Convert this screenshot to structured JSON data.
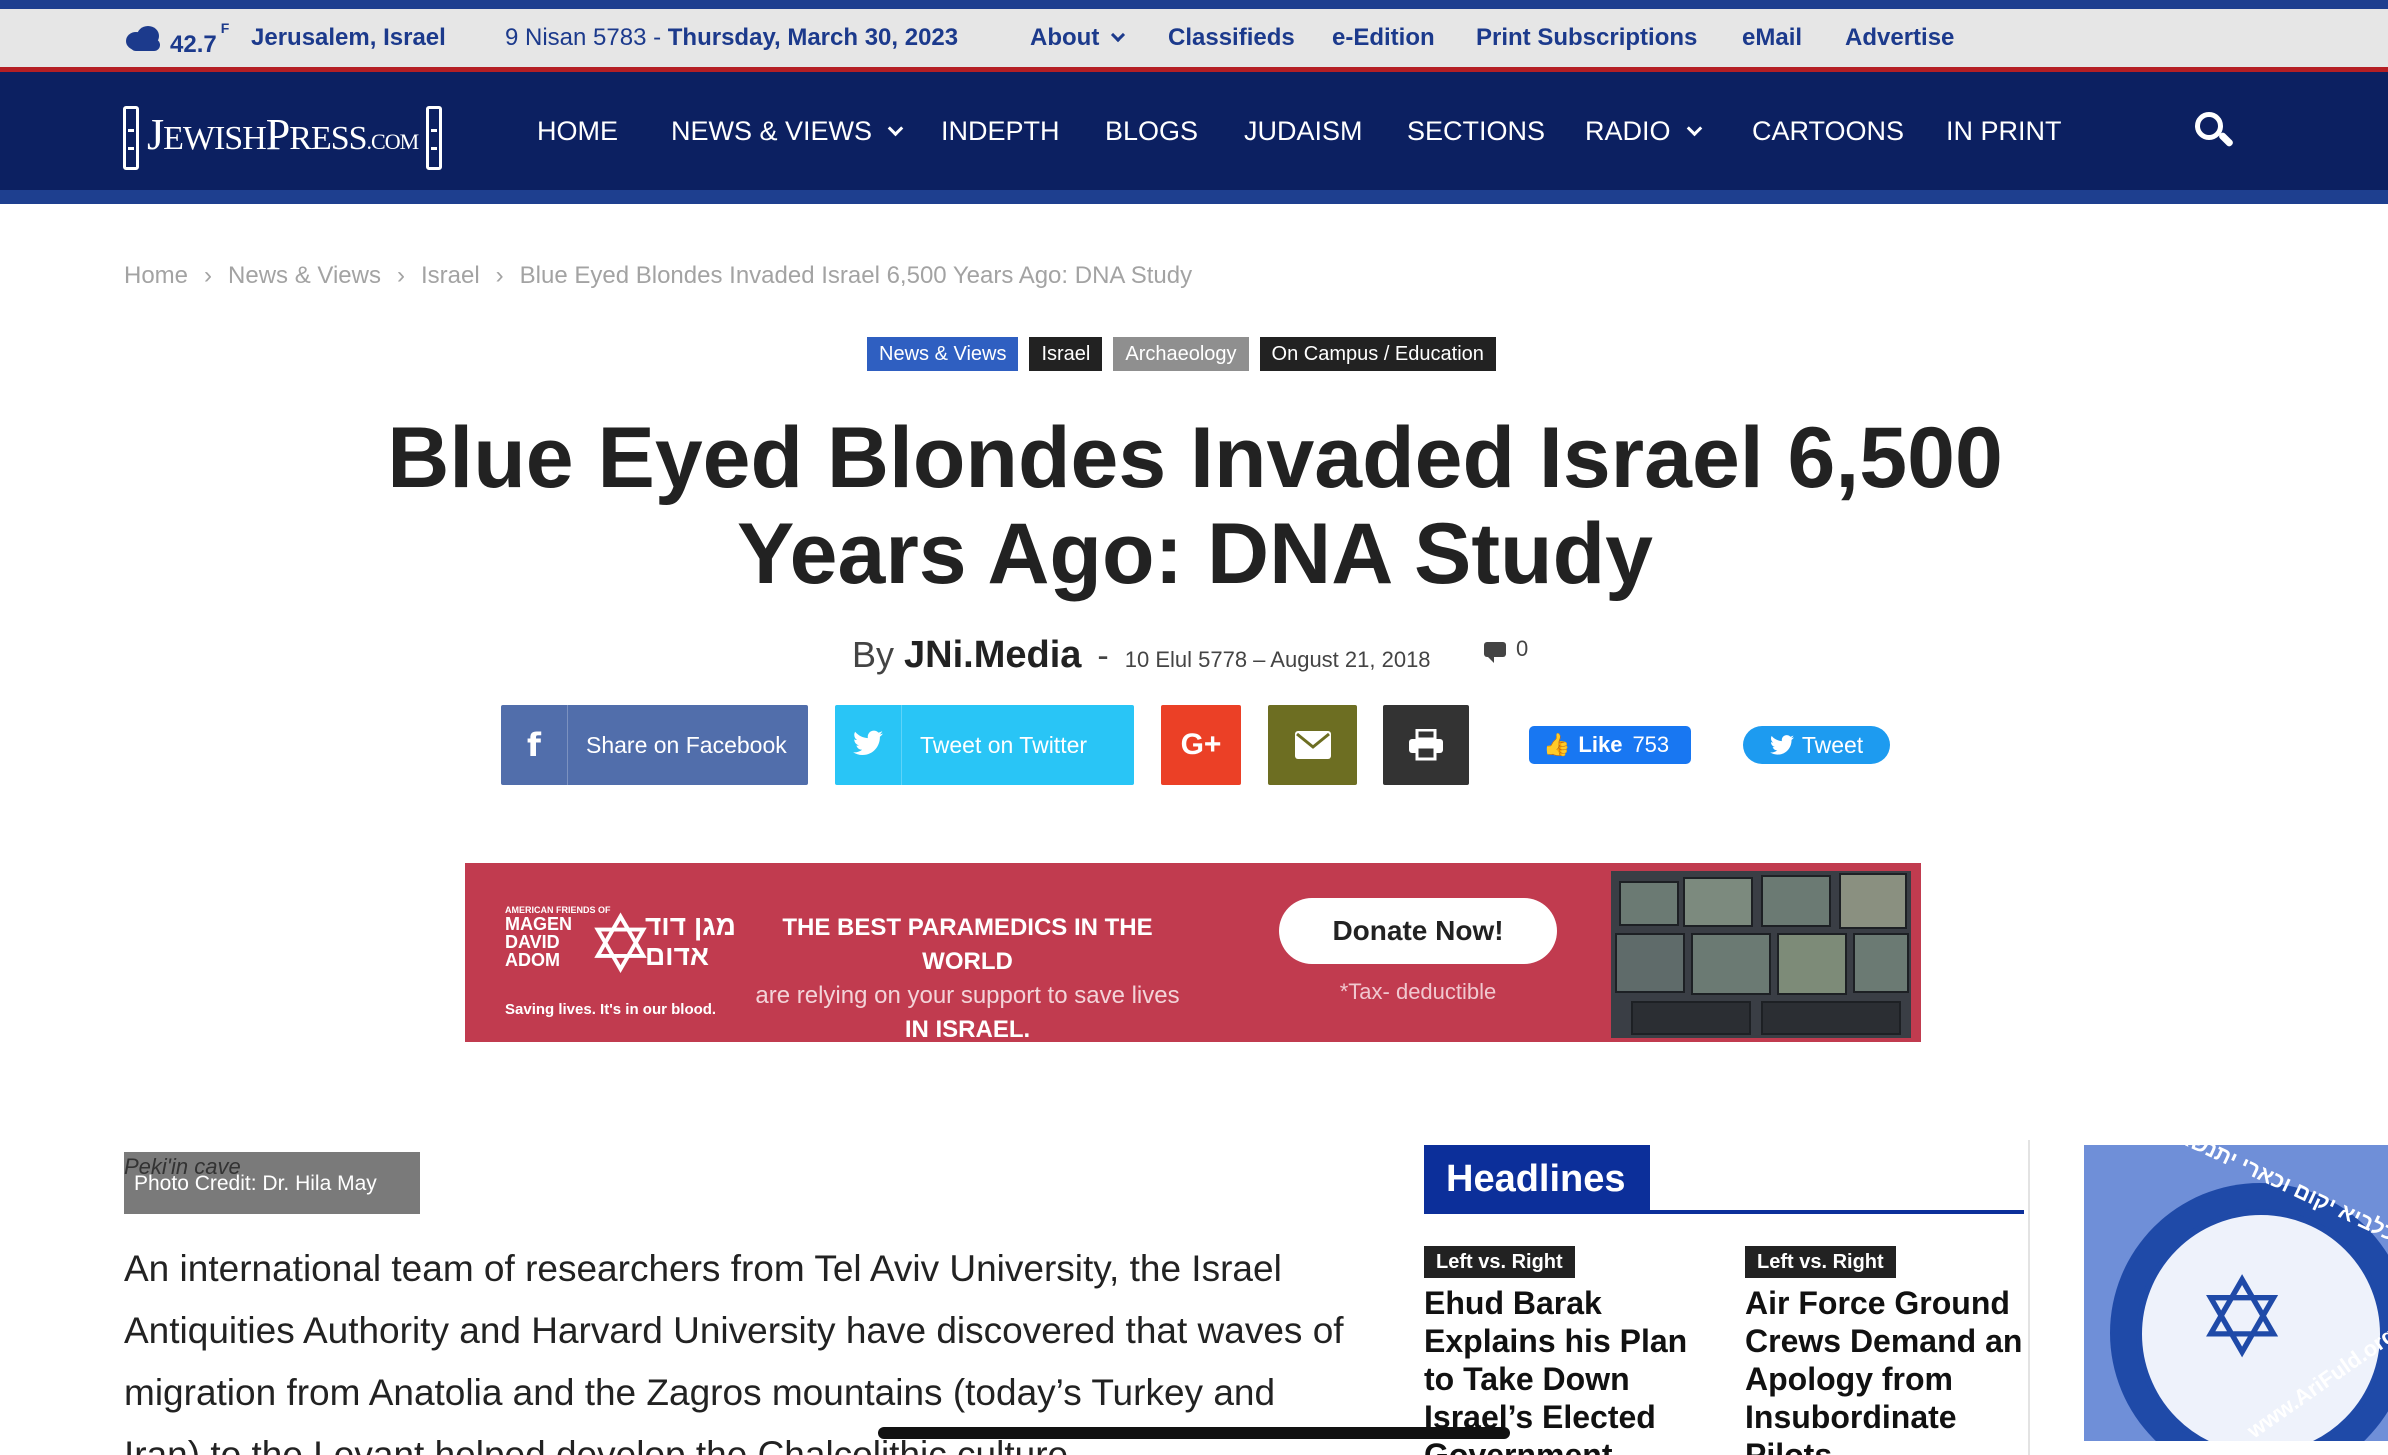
{
  "topbar": {
    "weather_icon": "cloud-icon",
    "temperature": "42.7",
    "temp_unit": "F",
    "location": "Jerusalem, Israel",
    "hebrew_date": "9 Nisan 5783 - ",
    "date": "Thursday, March 30, 2023",
    "links": [
      "About",
      "Classifieds",
      "e-Edition",
      "Print Subscriptions",
      "eMail",
      "Advertise"
    ]
  },
  "mainnav": {
    "logo_text": {
      "j": "J",
      "ewish": "EWISH",
      "p": "P",
      "ress": "RESS",
      "com": ".COM"
    },
    "items": [
      "HOME",
      "NEWS & VIEWS",
      "INDEPTH",
      "BLOGS",
      "JUDAISM",
      "SECTIONS",
      "RADIO",
      "CARTOONS",
      "IN PRINT"
    ],
    "search_icon": "search-icon"
  },
  "breadcrumb": [
    "Home",
    "News & Views",
    "Israel",
    "Blue Eyed Blondes Invaded Israel 6,500 Years Ago: DNA Study"
  ],
  "tags": [
    {
      "label": "News & Views",
      "color": "#2f5fc1"
    },
    {
      "label": "Israel",
      "color": "#222222"
    },
    {
      "label": "Archaeology",
      "color": "#8f8f8f"
    },
    {
      "label": "On Campus / Education",
      "color": "#222222"
    }
  ],
  "article": {
    "title": "Blue Eyed Blondes Invaded Israel 6,500 Years Ago: DNA Study",
    "by": "By",
    "author": "JNi.Media",
    "dash": "-",
    "date": "10 Elul 5778 – August 21, 2018",
    "comment_count": "0",
    "photo_caption": "Peki'in cave",
    "photo_credit": "Photo Credit: Dr. Hila May",
    "body": "An international team of researchers from Tel Aviv University, the Israel Antiquities Authority and Harvard University have discovered that waves of migration from Anatolia and the Zagros mountains (today’s Turkey and Iran) to the Levant helped develop the Chalcolithic culture"
  },
  "share": {
    "facebook": "Share on Facebook",
    "twitter": "Tweet on Twitter",
    "googleplus": "G+",
    "like_label": "Like",
    "like_count": "753",
    "tweet_label": "Tweet"
  },
  "ad": {
    "org_small": "AMERICAN FRIENDS OF",
    "org_name_1": "MAGEN",
    "org_name_2": "DAVID",
    "org_name_3": "ADOM",
    "org_hebrew_1": "מגן דוד",
    "org_hebrew_2": "אדום",
    "org_tagline": "Saving lives. It's in our blood.",
    "line1": "THE BEST PARAMEDICS IN THE WORLD",
    "line2": "are relying on your support to save lives",
    "line3": "IN ISRAEL.",
    "cta": "Donate Now!",
    "note": "*Tax- deductible",
    "bg_color": "#c13b4f"
  },
  "sidebar": {
    "headlines_title": "Headlines",
    "items": [
      {
        "category": "Left vs. Right",
        "headline": "Ehud Barak Explains his Plan to Take Down Israel’s Elected Government"
      },
      {
        "category": "Left vs. Right",
        "headline": "Air Force Ground Crews Demand an Apology from Insubordinate Pilots"
      }
    ],
    "promo_ring_text": "הן עם כלביא יקום וכארי יתנשא",
    "promo_url": "www.AriFuld.org"
  }
}
